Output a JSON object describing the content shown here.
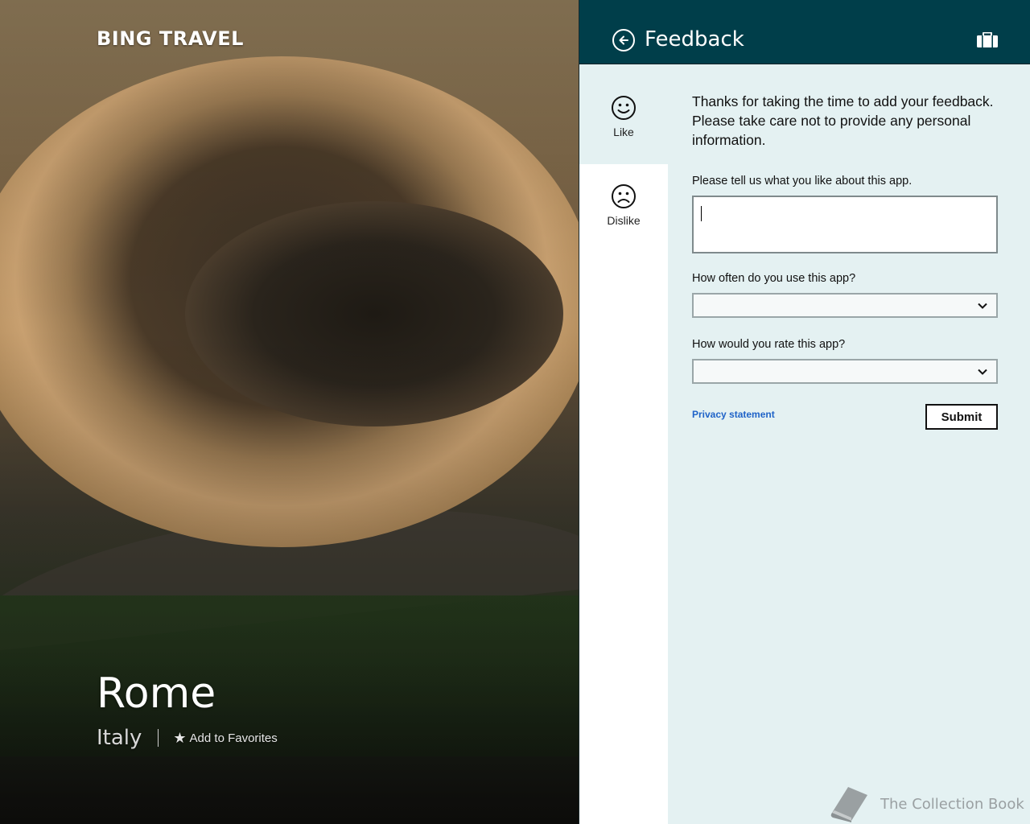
{
  "app": {
    "brand": "BING TRAVEL"
  },
  "destination": {
    "city": "Rome",
    "country": "Italy",
    "add_favorites_label": "Add to Favorites"
  },
  "flyout": {
    "title": "Feedback",
    "tabs": [
      {
        "label": "Like",
        "icon": "smile-icon",
        "selected": true
      },
      {
        "label": "Dislike",
        "icon": "frown-icon",
        "selected": false
      }
    ],
    "intro": "Thanks for taking the time to add your feedback. Please take care not to provide any personal information.",
    "question_like": "Please tell us what you like about this app.",
    "like_value": "",
    "question_frequency": "How often do you use this app?",
    "frequency_value": "",
    "question_rating": "How would you rate this app?",
    "rating_value": "",
    "privacy_label": "Privacy statement",
    "submit_label": "Submit"
  },
  "watermark": {
    "text": "The Collection Book"
  },
  "colors": {
    "header": "#003e4a",
    "panel": "#e4f1f2",
    "link": "#1f63c8"
  }
}
